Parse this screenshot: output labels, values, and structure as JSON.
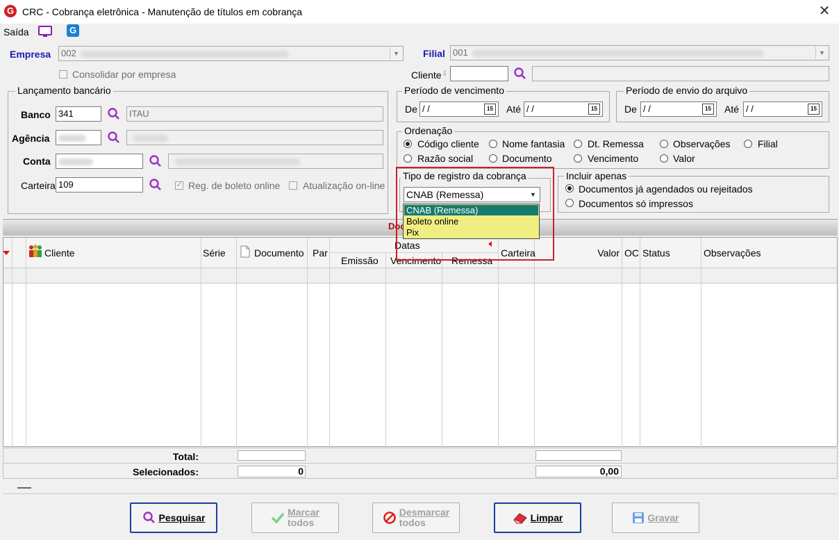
{
  "window": {
    "title": "CRC - Cobrança eletrônica - Manutenção de títulos em cobrança",
    "app_icon": "G"
  },
  "menu": {
    "exit_label": "Saída"
  },
  "empresa": {
    "label": "Empresa",
    "value": "002",
    "consolidar_label": "Consolidar por empresa"
  },
  "filial": {
    "label": "Filial",
    "value": "001"
  },
  "cliente": {
    "label": "Cliente"
  },
  "lancamento": {
    "title": "Lançamento bancário",
    "banco_label": "Banco",
    "banco_value": "341",
    "banco_name": "ITAU",
    "agencia_label": "Agência",
    "conta_label": "Conta",
    "carteira_label": "Carteira",
    "carteira_value": "109",
    "reg_boleto_label": "Reg. de boleto online",
    "atualizacao_label": "Atualização on-line"
  },
  "periodo_venc": {
    "title": "Período de vencimento",
    "de_label": "De",
    "de_value": "/ /",
    "ate_label": "Até",
    "ate_value": "/ /"
  },
  "periodo_envio": {
    "title": "Período de envio do arquivo",
    "de_label": "De",
    "de_value": "/ /",
    "ate_label": "Até",
    "ate_value": "/ /"
  },
  "calendar_glyph": "15",
  "ordenacao": {
    "title": "Ordenação",
    "options": [
      "Código cliente",
      "Nome fantasia",
      "Dt. Remessa",
      "Observações",
      "Filial",
      "Razão social",
      "Documento",
      "Vencimento",
      "Valor"
    ],
    "selected": "Código cliente"
  },
  "tipo_registro": {
    "title": "Tipo de registro da cobrança",
    "value": "CNAB (Remessa)",
    "options": [
      "CNAB (Remessa)",
      "Boleto online",
      "Pix"
    ]
  },
  "incluir": {
    "title": "Incluir apenas",
    "options": [
      "Documentos já agendados ou rejeitados",
      "Documentos só impressos"
    ],
    "selected": "Documentos já agendados ou rejeitados"
  },
  "section_title_partial": "Doc",
  "grid": {
    "headers": {
      "cliente": "Cliente",
      "serie": "Série",
      "documento": "Documento",
      "par": "Par",
      "datas": "Datas",
      "emissao": "Emissão",
      "vencimento": "Vencimento",
      "remessa": "Remessa",
      "carteira": "Carteira",
      "valor": "Valor",
      "oc": "OC",
      "status": "Status",
      "observacoes": "Observações"
    },
    "total_label": "Total:",
    "selecionados_label": "Selecionados:",
    "selecionados_count": "0",
    "selecionados_valor": "0,00"
  },
  "buttons": {
    "pesquisar": "Pesquisar",
    "marcar_1": "Marcar",
    "marcar_2": "todos",
    "desmarcar_1": "Desmarcar",
    "desmarcar_2": "todos",
    "limpar": "Limpar",
    "gravar": "Gravar"
  },
  "colors": {
    "accent_blue": "#1a1ab0",
    "highlight_red": "#cc2020",
    "dropdown_bg": "#f0ee82",
    "dropdown_selected": "#157a70"
  }
}
